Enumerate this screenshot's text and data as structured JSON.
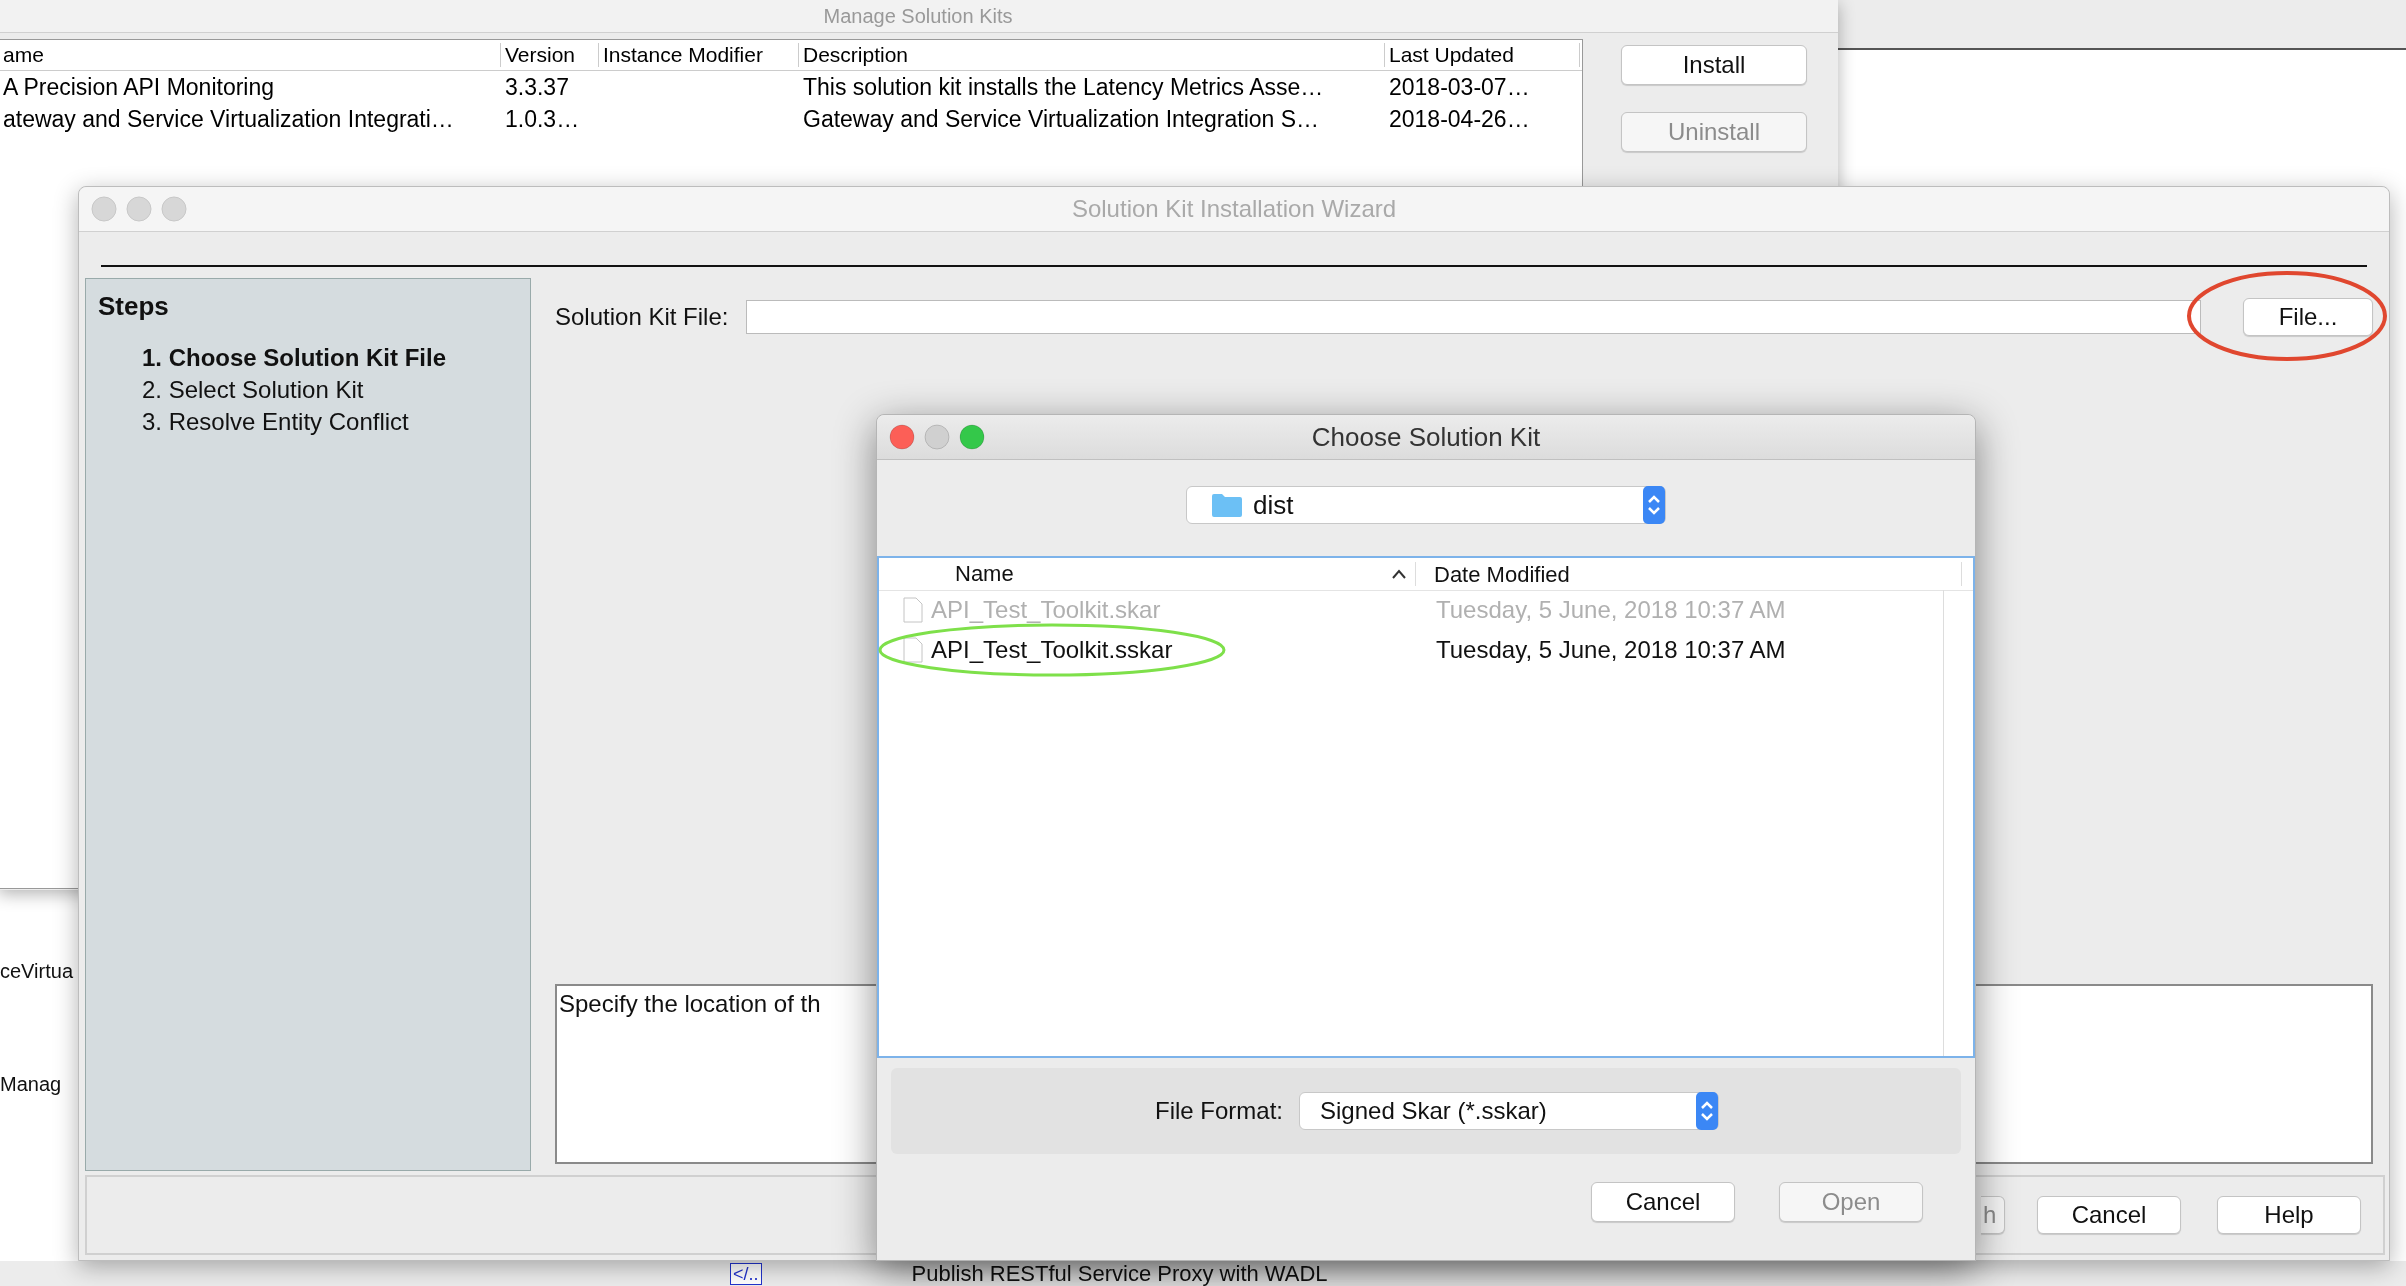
{
  "background_window": {
    "title": "Manage Solution Kits",
    "columns": [
      "ame",
      "Version",
      "Instance Modifier",
      "Description",
      "Last Updated"
    ],
    "rows": [
      {
        "name": "A Precision API Monitoring",
        "version": "3.3.37",
        "description": "This solution kit installs the Latency Metrics Asse…",
        "last_updated": "2018-03-07…"
      },
      {
        "name": "ateway and Service Virtualization Integrati…",
        "version": "1.0.3…",
        "description": "Gateway and Service Virtualization Integration S…",
        "last_updated": "2018-04-26…"
      }
    ],
    "buttons": [
      {
        "label": "Install",
        "disabled": false
      },
      {
        "label": "Uninstall",
        "disabled": true
      }
    ]
  },
  "behind_texts": [
    "ceVirtua",
    "Manag"
  ],
  "bottom_strip": {
    "code_badge": "</..",
    "text": "Publish RESTful Service Proxy with WADL"
  },
  "wizard": {
    "title": "Solution Kit Installation Wizard",
    "active": false,
    "steps_title": "Steps",
    "steps": [
      {
        "label": "1. Choose Solution Kit File",
        "selected": true
      },
      {
        "label": "2. Select Solution Kit",
        "selected": false
      },
      {
        "label": "3. Resolve Entity Conflict",
        "selected": false
      }
    ],
    "file_label": "Solution Kit File:",
    "file_button": {
      "label": "File...",
      "highlighted": true
    },
    "description": "Specify the location of th",
    "buttons": [
      {
        "label": "h",
        "disabled": true
      },
      {
        "label": "Cancel",
        "disabled": false
      },
      {
        "label": "Help",
        "disabled": false
      }
    ]
  },
  "chooser": {
    "title": "Choose Solution Kit",
    "active": true,
    "folder": "dist",
    "columns": [
      {
        "label": "Name",
        "sorted": true
      },
      {
        "label": "Date Modified",
        "sorted": false
      }
    ],
    "files": [
      {
        "name": "API_Test_Toolkit.skar",
        "modified": "Tuesday, 5 June, 2018 10:37 AM",
        "disabled": true,
        "highlighted": false
      },
      {
        "name": "API_Test_Toolkit.sskar",
        "modified": "Tuesday, 5 June, 2018 10:37 AM",
        "disabled": false,
        "highlighted": true
      }
    ],
    "format_label": "File Format:",
    "format": "Signed Skar (*.sskar)",
    "buttons": [
      {
        "label": "Cancel",
        "disabled": false
      },
      {
        "label": "Open",
        "disabled": true
      }
    ]
  }
}
